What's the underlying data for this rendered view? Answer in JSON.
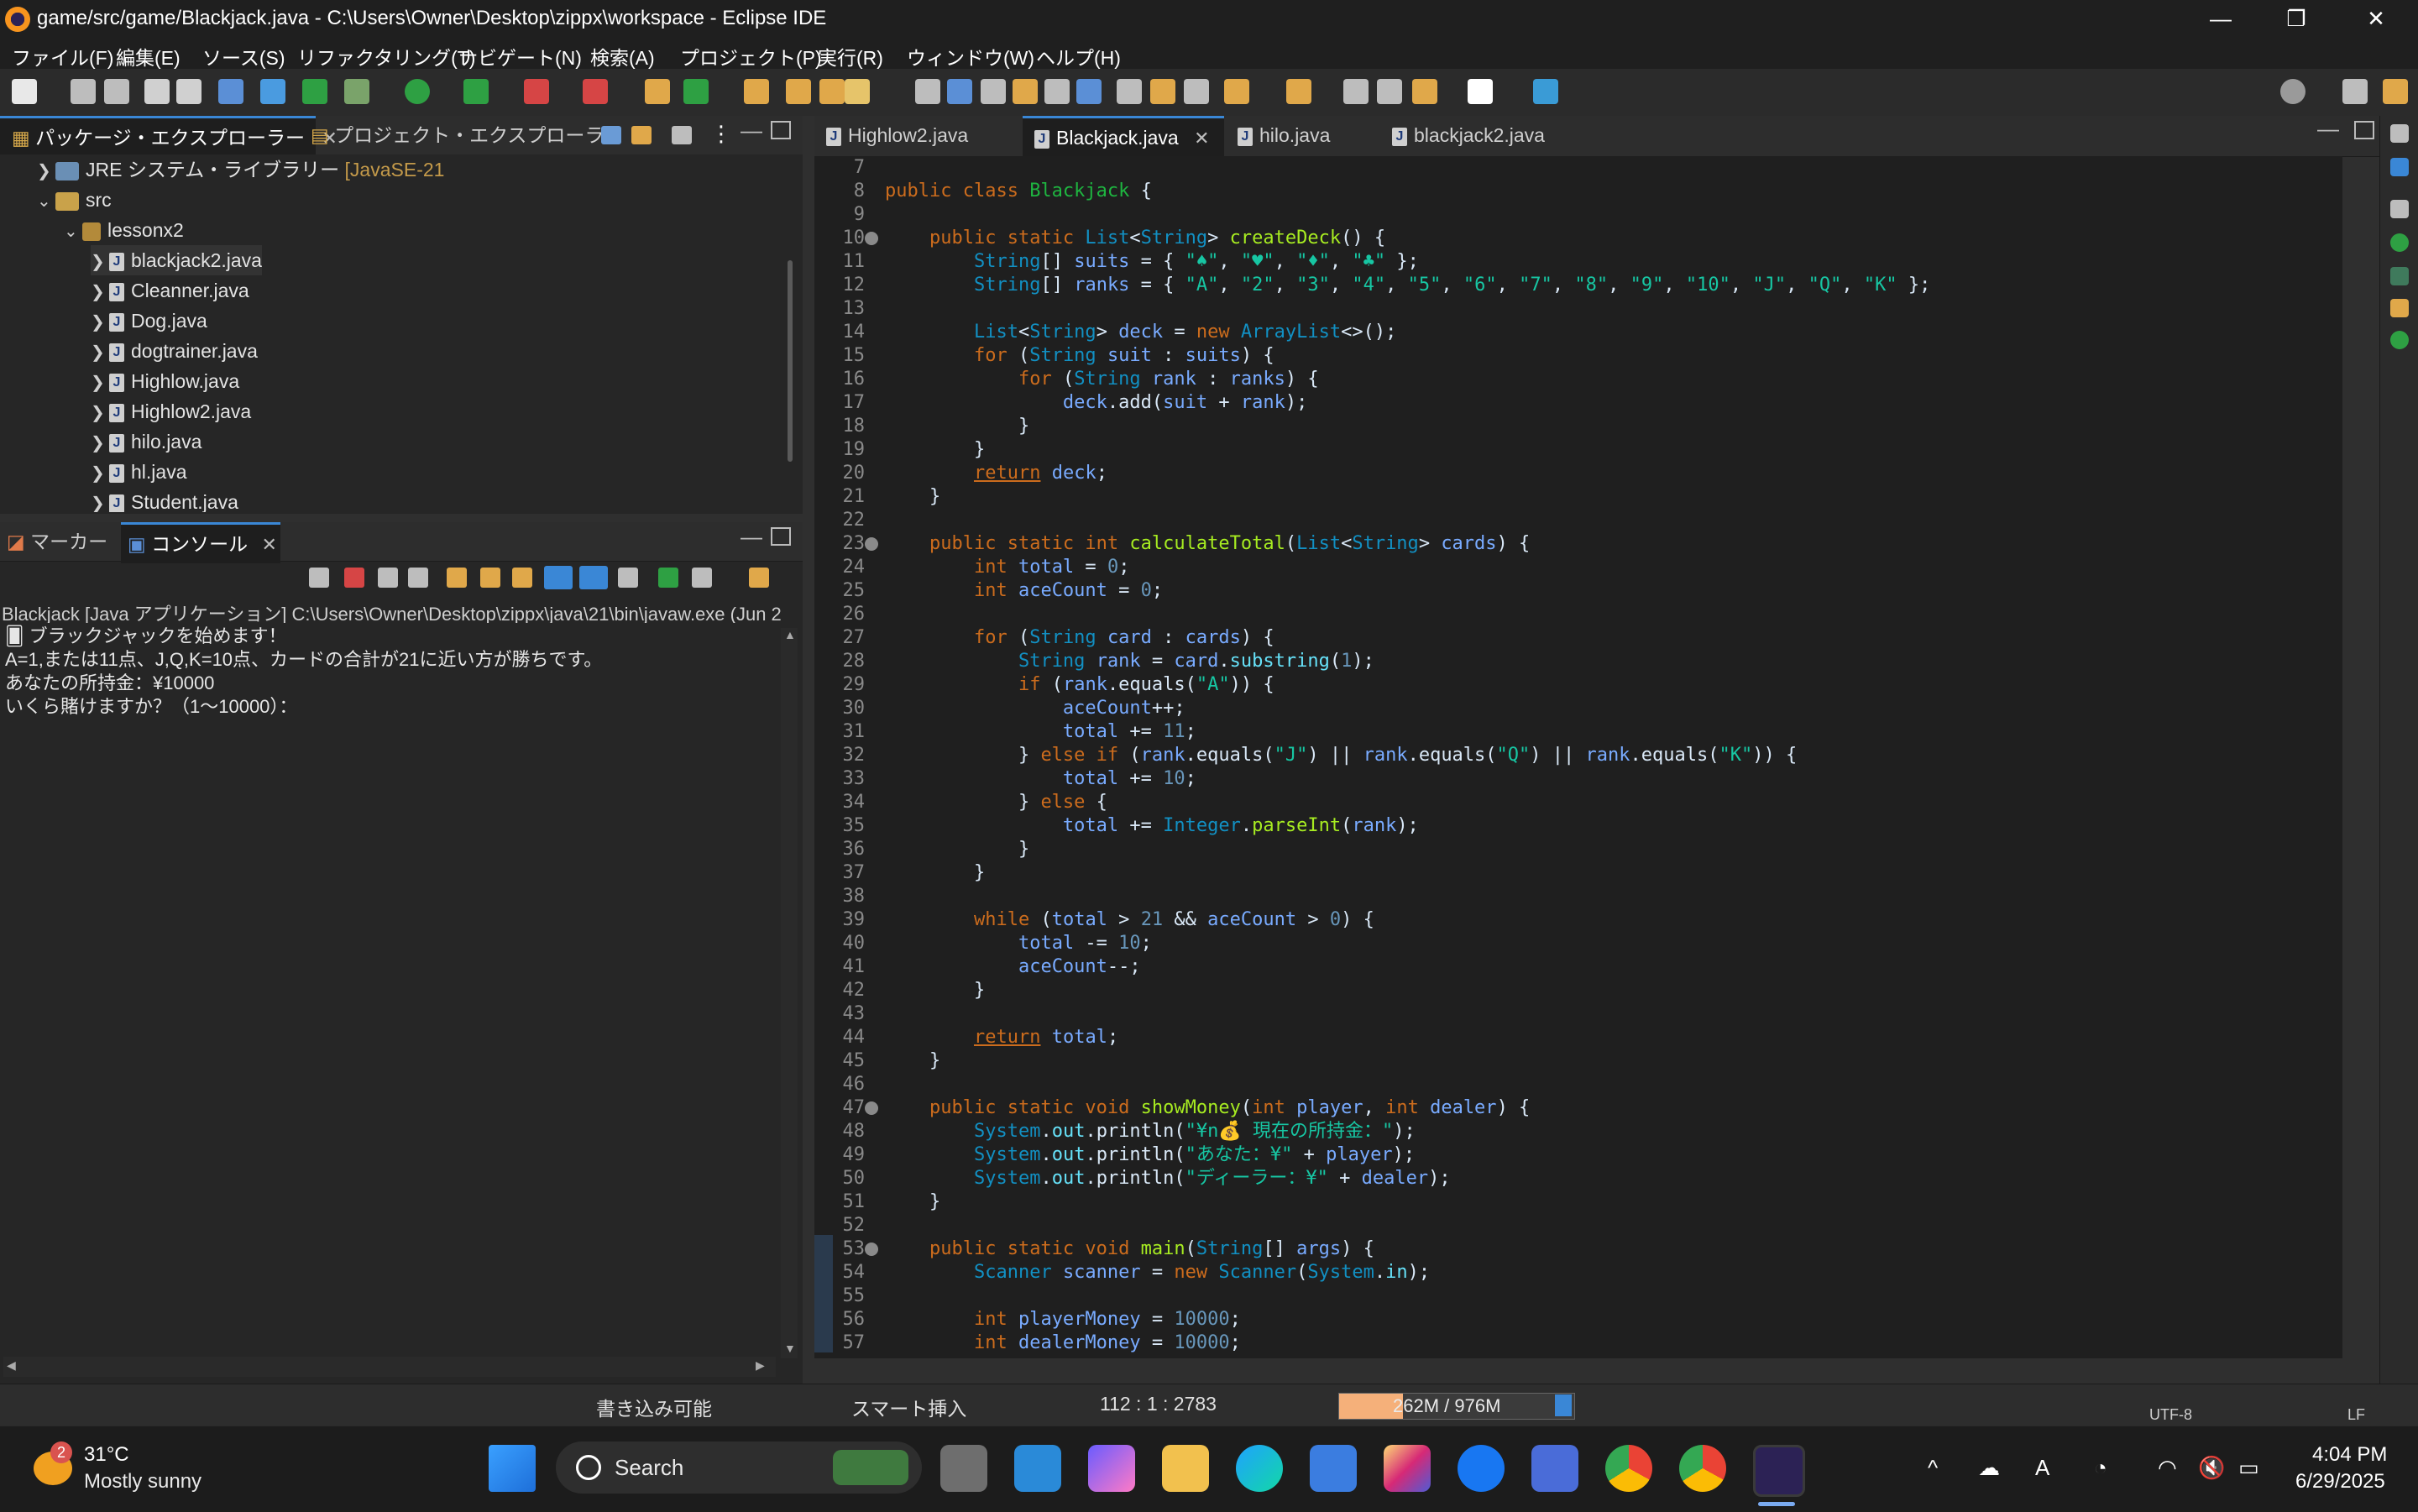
{
  "window": {
    "title": "game/src/game/Blackjack.java - C:\\Users\\Owner\\Desktop\\zippx\\workspace - Eclipse IDE",
    "controls": [
      "—",
      "❐",
      "✕"
    ]
  },
  "menu": [
    "ファイル(F)",
    "編集(E)",
    "ソース(S)",
    "リファクタリング(T)",
    "ナビゲート(N)",
    "検索(A)",
    "プロジェクト(P)",
    "実行(R)",
    "ウィンドウ(W)",
    "ヘルプ(H)"
  ],
  "explorer": {
    "tabs": [
      "パッケージ・エクスプローラー",
      "プロジェクト・エクスプローラー"
    ],
    "tree": [
      {
        "label": "JRE システム・ライブラリー",
        "extra": "[JavaSE-21",
        "icon": "library-icon"
      },
      {
        "label": "src",
        "icon": "source-folder-icon"
      },
      {
        "label": "lessonx2",
        "icon": "package-icon"
      },
      {
        "label": "blackjack2.java",
        "icon": "java-file-icon"
      },
      {
        "label": "Cleanner.java",
        "icon": "java-file-icon"
      },
      {
        "label": "Dog.java",
        "icon": "java-file-icon"
      },
      {
        "label": "dogtrainer.java",
        "icon": "java-file-icon"
      },
      {
        "label": "Highlow.java",
        "icon": "java-file-icon"
      },
      {
        "label": "Highlow2.java",
        "icon": "java-file-icon"
      },
      {
        "label": "hilo.java",
        "icon": "java-file-icon"
      },
      {
        "label": "hl.java",
        "icon": "java-file-icon"
      },
      {
        "label": "Student.java",
        "icon": "java-file-icon"
      }
    ]
  },
  "console": {
    "tabs": [
      "マーカー",
      "コンソール"
    ],
    "header": "Blackjack [Java アプリケーション] C:\\Users\\Owner\\Desktop\\zippx\\java\\21\\bin\\javaw.exe  (Jun 2",
    "lines": [
      "🂠 ブラックジャックを始めます！",
      "A=1,または11点、J,Q,K=10点、カードの合計が21に近い方が勝ちです。",
      "あなたの所持金：¥10000",
      "いくら賭けますか？（1〜10000）："
    ]
  },
  "editor": {
    "tabs": [
      "Highlow2.java",
      "Blackjack.java",
      "hilo.java",
      "blackjack2.java"
    ],
    "active_tab": "Blackjack.java",
    "first_line": 7,
    "fold_lines": [
      10,
      23,
      47,
      53
    ]
  },
  "status": {
    "writable": "書き込み可能",
    "insert_mode": "スマート挿入",
    "position": "112 : 1 : 2783",
    "memory": "262M / 976M",
    "memory_fraction": 0.27,
    "encoding": "UTF-8",
    "line_ending": "LF"
  },
  "taskbar": {
    "weather_temp": "31°C",
    "weather_desc": "Mostly sunny",
    "weather_badge": "2",
    "search_label": "Search",
    "time": "4:04 PM",
    "date": "6/29/2025"
  },
  "colors": {
    "keyword": "#cc6c1d",
    "type": "#1290c3",
    "class_name": "#1eb540",
    "string": "#17c6a3",
    "accent": "#3a87d6"
  }
}
